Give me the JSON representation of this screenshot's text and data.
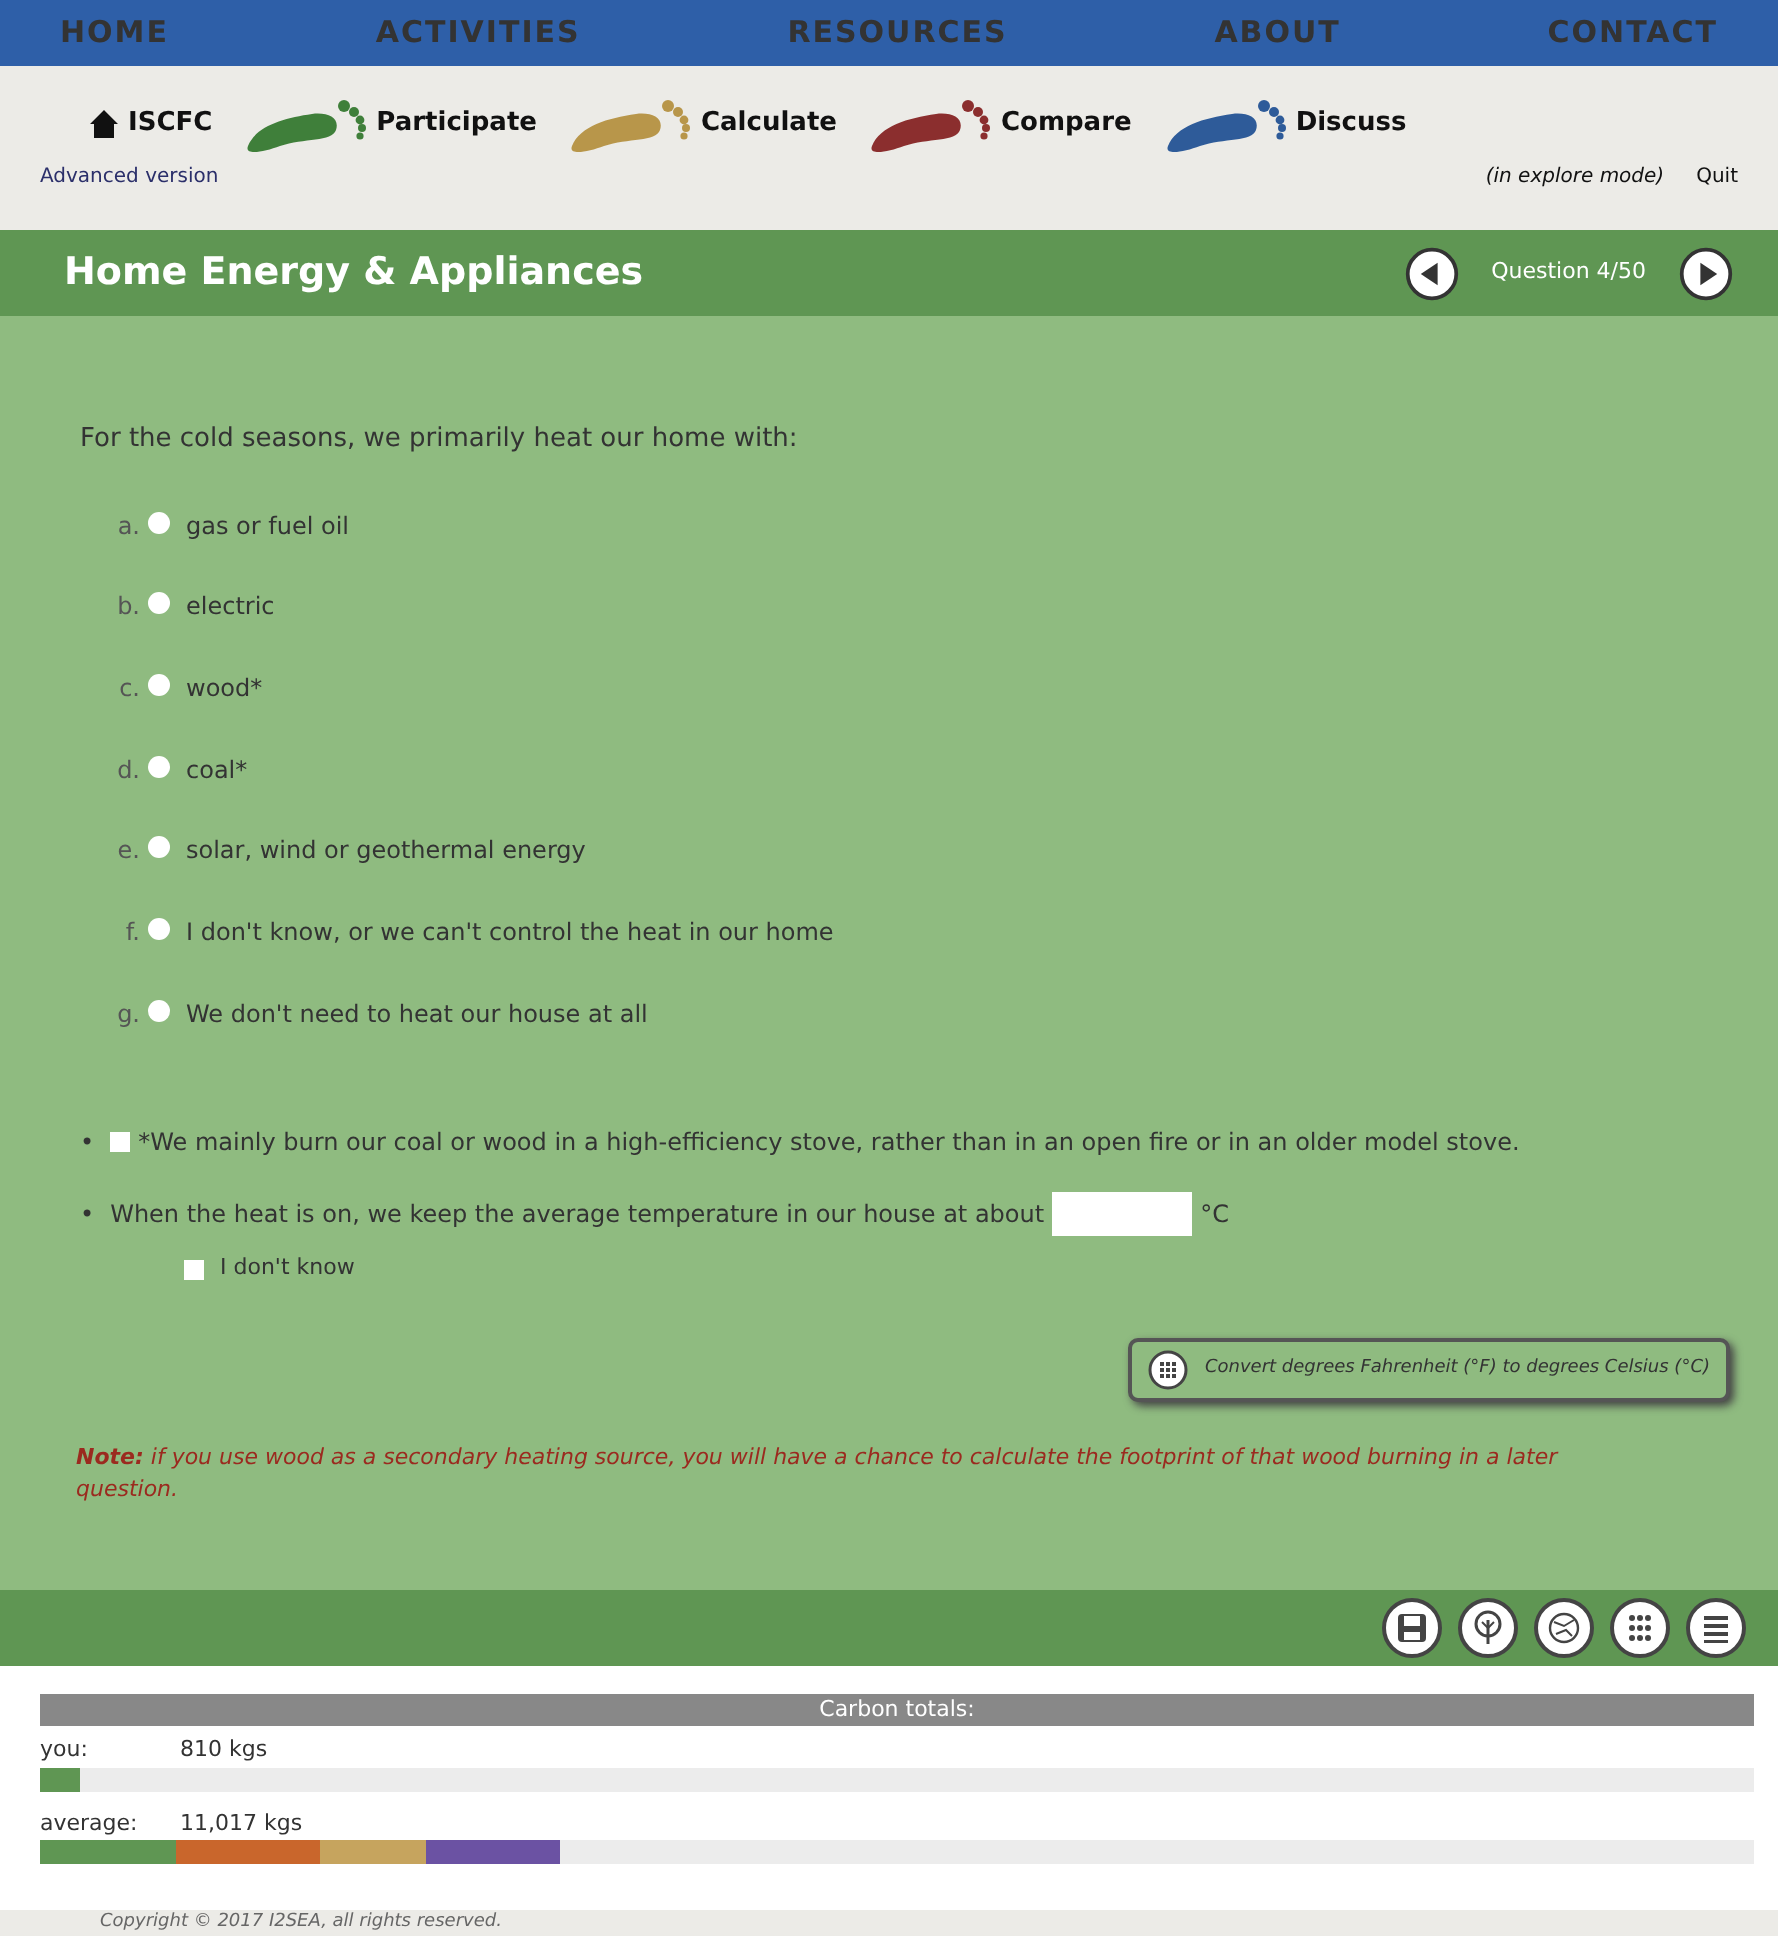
{
  "top_nav": [
    {
      "label": "HOME"
    },
    {
      "label": "ACTIVITIES"
    },
    {
      "label": "RESOURCES"
    },
    {
      "label": "ABOUT"
    },
    {
      "label": "CONTACT"
    }
  ],
  "steps": [
    {
      "label": "ISCFC",
      "kind": "home"
    },
    {
      "label": "Participate",
      "kind": "foot",
      "color": "#3f7f3a"
    },
    {
      "label": "Calculate",
      "kind": "foot",
      "color": "#b8964a"
    },
    {
      "label": "Compare",
      "kind": "foot",
      "color": "#8b2e2e"
    },
    {
      "label": "Discuss",
      "kind": "foot",
      "color": "#2e5b99"
    }
  ],
  "version_link": "Advanced version",
  "mode": "(in explore mode)",
  "quit": "Quit",
  "section_title": "Home Energy & Appliances",
  "question_counter": "Question 4/50",
  "question": "For the cold seasons, we primarily heat our home with:",
  "options": [
    {
      "letter": "a.",
      "text": "gas or fuel oil",
      "selected": false
    },
    {
      "letter": "b.",
      "text": "electric",
      "selected": false
    },
    {
      "letter": "c.",
      "text": "wood*",
      "selected": false
    },
    {
      "letter": "d.",
      "text": "coal*",
      "selected": false
    },
    {
      "letter": "e.",
      "text": "solar, wind or geothermal energy",
      "selected": false
    },
    {
      "letter": "f.",
      "text": "I don't know, or we can't control the heat in our home",
      "selected": false
    },
    {
      "letter": "g.",
      "text": "We don't need to heat our house at all",
      "selected": false
    }
  ],
  "stove_check": {
    "bullet": "•",
    "text": "*We mainly burn our coal or wood in a high-efficiency stove, rather than in an open fire or in an older model stove.",
    "checked": false
  },
  "temperature": {
    "bullet": "•",
    "text": "When the heat is on, we keep the average temperature in our house at about",
    "unit": "°C",
    "dont_know": {
      "text": "I don't know",
      "checked": false
    }
  },
  "convert_button": "Convert degrees Fahrenheit (°F) to degrees Celsius (°C)",
  "note": "**Note:** *if you use wood as a secondary heating source, you will have a chance to calculate the footprint of that wood burning in a later question.*",
  "toolbar": [
    {
      "kind": "save"
    },
    {
      "kind": "tree"
    },
    {
      "kind": "globe"
    },
    {
      "kind": "grid"
    },
    {
      "kind": "list"
    }
  ],
  "carbon": {
    "title": "Carbon totals:",
    "rows": [
      {
        "label": "you:",
        "value": "810 kgs",
        "segments": [
          {
            "color": "#5f9653",
            "level": 0.023
          }
        ]
      },
      {
        "label": "average:",
        "value": "11,017 kgs",
        "segments": [
          {
            "color": "#5f9653"
          },
          {
            "color": "#c9662c"
          },
          {
            "color": "#c6a45e"
          },
          {
            "color": "#6b52a3"
          }
        ]
      }
    ]
  },
  "copyright": "Copyright © 2017 I2SEA, all rights reserved."
}
